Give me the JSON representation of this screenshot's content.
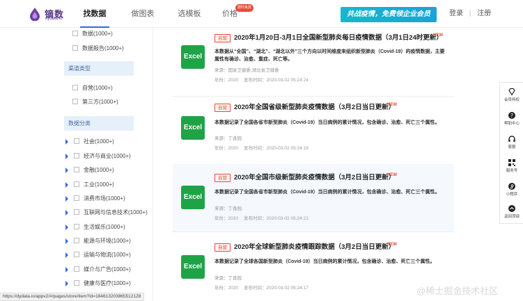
{
  "header": {
    "logo_text": "镝数",
    "logo_sub": "dydata.io",
    "nav": [
      "找数据",
      "做图表",
      "选模板",
      "价格"
    ],
    "nav_badge": "限时免费",
    "banner": "共战疫情，免费领企业会员",
    "login": "登录",
    "divider": "|",
    "register": "注册"
  },
  "sidebar": {
    "top_options": [
      "数据(1000+)",
      "数据报告(1000+)"
    ],
    "channel_title": "渠道类型",
    "channel_options": [
      "自营(1000+)",
      "第三方(1000+)"
    ],
    "category_title": "数据分类",
    "categories": [
      "社会(1000+)",
      "经济与商业(1000+)",
      "金融(1000+)",
      "工业(1000+)",
      "消费市场(1000+)",
      "互联网与信息技术(1000+)",
      "生活娱乐(1000+)",
      "能源与环境(1000+)",
      "运输与物流(1000+)",
      "媒介与广告(1000+)",
      "健康与医疗(1000+)"
    ]
  },
  "cards": [
    {
      "icon": "Excel",
      "tag": "自营",
      "title": "2020年1月20日-3月1日全国新型肺炎每日疫情数据（3月1日24时更新）",
      "new": "NEW",
      "desc": "本数据从“全国”、“湖北”、“湖北以外”三个方向以时间维度来组织新型肺炎（Covid-19）的疫情数据，主要属性有确诊、治愈、重症、死亡等。",
      "source": "来源：国家卫健委,湖北省卫健委",
      "year": "年份：2020",
      "published": "发布时间：2020-03-02 05:24:24"
    },
    {
      "icon": "Excel",
      "tag": "自营",
      "title": "2020年全国省级新型肺炎疫情数据（3月2日当日更新）",
      "new": "NEW",
      "desc": "本数据记录了全国各省市新型肺炎（Covid-19）当日病例的累计情况，包含确诊、治愈、死亡三个属性。",
      "source": "来源：丁香园",
      "year": "年份：2020",
      "published": "发布时间：2020-03-02 05:24:19"
    },
    {
      "icon": "Excel",
      "tag": "自营",
      "title": "2020年全国市级新型肺炎疫情数据（3月2日当日更新）",
      "new": "NEW",
      "desc": "本数据记录了全国各省市新型肺炎（Covid-19）当日病例的累计情况，包含确诊、治愈、死亡三个属性。",
      "source": "来源：丁香园",
      "year": "年份：2020",
      "published": "发布时间：2020-03-02 05:24:21"
    },
    {
      "icon": "Excel",
      "tag": "自营",
      "title": "2020年全球新型肺炎疫情跟踪数据（3月2日当日更新）",
      "new": "NEW",
      "desc": "本数据记录了全球各国新型肺炎（Covid-19）当日病例的累计情况，包含确诊、治愈、死亡三个属性。",
      "source": "来源：丁香园",
      "year": "年份：2020",
      "published": "发布时间：2020-03-02 05:24:17"
    }
  ],
  "floatbar": [
    "会员特权",
    "帮助中心",
    "客服",
    "服务号",
    "小程序",
    "返回顶部"
  ],
  "status_url": "https://dydata.io/appv2/#/pages/store/item?id=184613203865512128",
  "watermark": "@稀土掘金技术社区"
}
